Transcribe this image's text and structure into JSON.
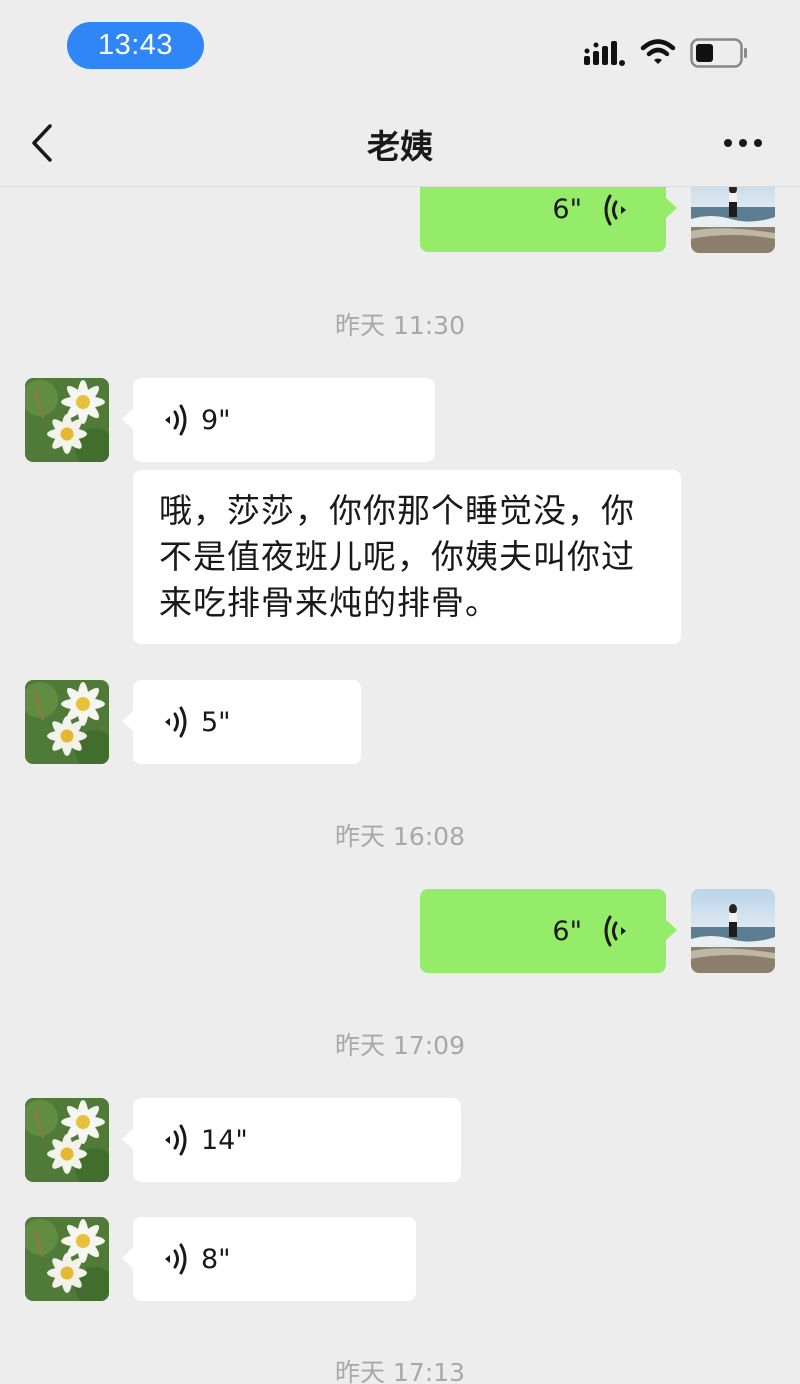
{
  "status_bar": {
    "time": "13:43"
  },
  "header": {
    "title": "老姨"
  },
  "messages": [
    {
      "type": "voice",
      "side": "right",
      "duration": "6\""
    },
    {
      "type": "timestamp",
      "text": "昨天 11:30"
    },
    {
      "type": "voice",
      "side": "left",
      "duration": "9\""
    },
    {
      "type": "text",
      "side": "left",
      "lines": [
        "哦，莎莎，你你那个睡觉没，你",
        "不是值夜班儿呢，你姨夫叫你过",
        "来吃排骨来炖的排骨。"
      ]
    },
    {
      "type": "voice",
      "side": "left",
      "duration": "5\""
    },
    {
      "type": "timestamp",
      "text": "昨天 16:08"
    },
    {
      "type": "voice",
      "side": "right",
      "duration": "6\""
    },
    {
      "type": "timestamp",
      "text": "昨天 17:09"
    },
    {
      "type": "voice",
      "side": "left",
      "duration": "14\""
    },
    {
      "type": "voice",
      "side": "left",
      "duration": "8\""
    },
    {
      "type": "timestamp",
      "text": "昨天 17:13"
    }
  ],
  "colors": {
    "background": "#ededed",
    "sent_bubble": "#95ec69",
    "received_bubble": "#ffffff",
    "time_pill": "#2f86f6",
    "timestamp_text": "#a8a8a8"
  },
  "icons": {
    "back": "chevron-left-icon",
    "more": "more-horizontal-icon",
    "voice": "voice-wave-icon",
    "signal": "signal-icon",
    "wifi": "wifi-icon",
    "battery": "battery-icon"
  }
}
